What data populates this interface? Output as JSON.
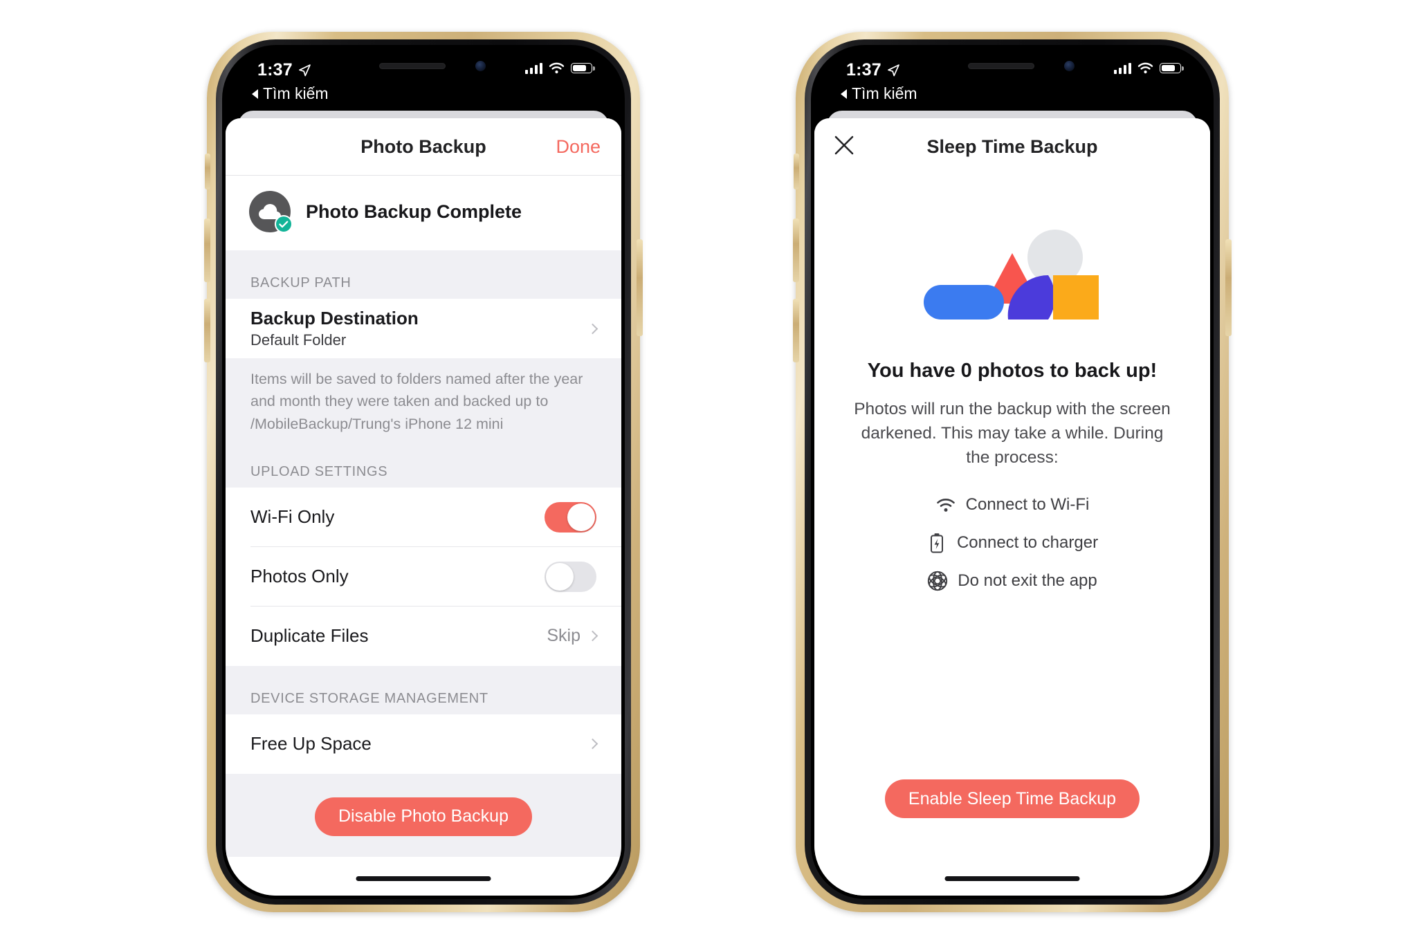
{
  "colors": {
    "accent": "#f4695f",
    "teal": "#12b498",
    "blue": "#3b7bf0",
    "red": "#f8554e",
    "purple": "#4b3bdb",
    "orange": "#fbaa1a",
    "gray_shape": "#e3e5e8",
    "section_bg": "#f0f0f4"
  },
  "phones": [
    {
      "status_bar": {
        "time": "1:37",
        "location_icon": "location-arrow-icon",
        "signal_icon": "cellular-bars-icon",
        "wifi_icon": "wifi-icon",
        "battery_icon": "battery-icon"
      },
      "back_link": {
        "label": "Tìm kiếm",
        "icon": "back-triangle-icon"
      },
      "navbar": {
        "title": "Photo Backup",
        "done_label": "Done"
      },
      "status_row": {
        "icon": "cloud-icon",
        "badge_icon": "check-icon",
        "text": "Photo Backup Complete"
      },
      "sections": [
        {
          "header": "BACKUP PATH",
          "rows": [
            {
              "title": "Backup Destination",
              "subtitle": "Default Folder",
              "accessory": "chevron-right-icon"
            }
          ],
          "footnote": "Items will be saved to folders named after the year and month they were taken and backed up to /MobileBackup/Trung's iPhone 12 mini"
        },
        {
          "header": "UPLOAD SETTINGS",
          "rows": [
            {
              "title": "Wi-Fi Only",
              "accessory": "toggle",
              "toggle_on": true
            },
            {
              "title": "Photos Only",
              "accessory": "toggle",
              "toggle_on": false
            },
            {
              "title": "Duplicate Files",
              "value": "Skip",
              "accessory": "chevron-right-icon"
            }
          ]
        },
        {
          "header": "DEVICE STORAGE MANAGEMENT",
          "rows": [
            {
              "title": "Free Up Space",
              "accessory": "chevron-right-icon"
            }
          ]
        }
      ],
      "primary_button": "Disable Photo Backup"
    },
    {
      "status_bar": {
        "time": "1:37",
        "location_icon": "location-arrow-icon",
        "signal_icon": "cellular-bars-icon",
        "wifi_icon": "wifi-icon",
        "battery_icon": "battery-icon"
      },
      "back_link": {
        "label": "Tìm kiếm",
        "icon": "back-triangle-icon"
      },
      "navbar": {
        "title": "Sleep Time Backup",
        "close_icon": "close-icon"
      },
      "illustration": "geometric-shapes-illustration",
      "headline": "You have 0 photos to back up!",
      "subtext": "Photos will run the backup with the screen darkened. This may take a while. During the process:",
      "bullets": [
        {
          "icon": "wifi-icon",
          "label": "Connect to Wi-Fi"
        },
        {
          "icon": "battery-charging-icon",
          "label": "Connect to charger"
        },
        {
          "icon": "rosette-app-icon",
          "label": "Do not exit the app"
        }
      ],
      "primary_button": "Enable Sleep Time Backup"
    }
  ]
}
